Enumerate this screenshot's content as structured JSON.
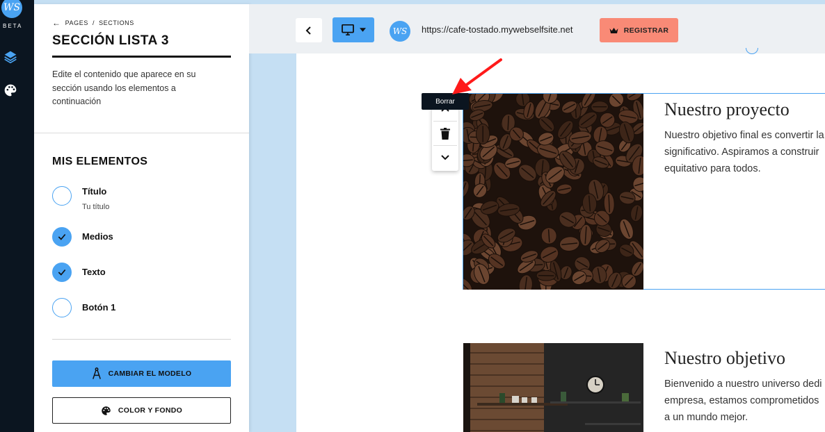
{
  "rail": {
    "logo_text": "WS",
    "beta_label": "BETA",
    "icons": [
      "layers-icon",
      "palette-icon"
    ]
  },
  "panel": {
    "breadcrumb": {
      "pages": "PAGES",
      "separator": "/",
      "sections": "SECTIONS"
    },
    "title": "SECCIÓN LISTA 3",
    "description": "Edite el contenido que aparece en su sección usando los elementos a continuación",
    "elements_heading": "MIS ELEMENTOS",
    "elements": [
      {
        "label": "Título",
        "sublabel": "Tu título",
        "checked": false
      },
      {
        "label": "Medios",
        "checked": true
      },
      {
        "label": "Texto",
        "checked": true
      },
      {
        "label": "Botón 1",
        "checked": false
      }
    ],
    "change_model_label": "CAMBIAR EL MODELO",
    "color_background_label": "COLOR Y FONDO"
  },
  "topbar": {
    "url": "https://cafe-tostado.mywebselfsite.net",
    "register_label": "REGISTRAR",
    "site_logo_text": "WS"
  },
  "canvas": {
    "tooltip": "Borrar",
    "section1": {
      "heading": "Nuestro proyecto",
      "lines": [
        "Nuestro objetivo final es convertir la",
        "significativo. Aspiramos a construir",
        "equitativo para todos."
      ]
    },
    "section2": {
      "heading": "Nuestro objetivo",
      "lines": [
        "Bienvenido a nuestro universo dedi",
        "empresa, estamos comprometidos",
        "a un mundo mejor."
      ]
    }
  },
  "colors": {
    "accent": "#4aa3f2",
    "register": "#f98a76",
    "rail": "#0b1520"
  }
}
